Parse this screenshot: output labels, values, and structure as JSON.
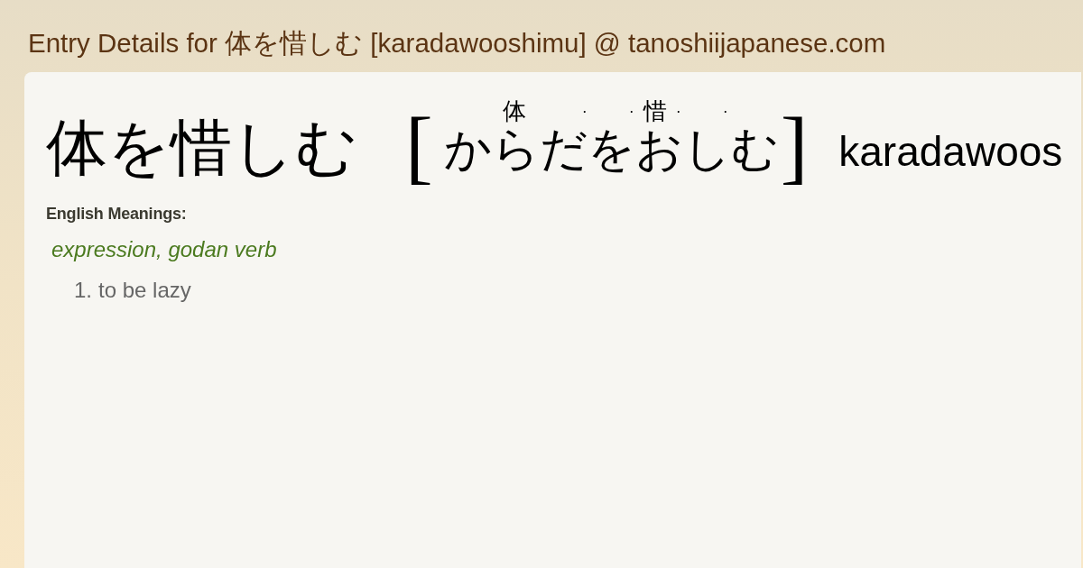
{
  "header": {
    "title": "Entry Details for 体を惜しむ [karadawooshimu] @ tanoshiijapanese.com"
  },
  "entry": {
    "headword": "体を惜しむ",
    "reading_open": "[",
    "reading": [
      {
        "kana": "か"
      },
      {
        "kana": "ら",
        "ruby": "体"
      },
      {
        "kana": "だ",
        "mark_after": "·"
      },
      {
        "kana": "を",
        "mark_after": "·"
      },
      {
        "kana": "お",
        "ruby": "惜",
        "mark_after": "·"
      },
      {
        "kana": "し",
        "mark_after": "·"
      },
      {
        "kana": "む"
      }
    ],
    "reading_close": "]",
    "romaji": "karadawoos"
  },
  "meanings": {
    "heading": "English Meanings:",
    "part_of_speech": "expression, godan verb",
    "senses": [
      {
        "number": "1.",
        "text": "to be lazy"
      }
    ]
  }
}
